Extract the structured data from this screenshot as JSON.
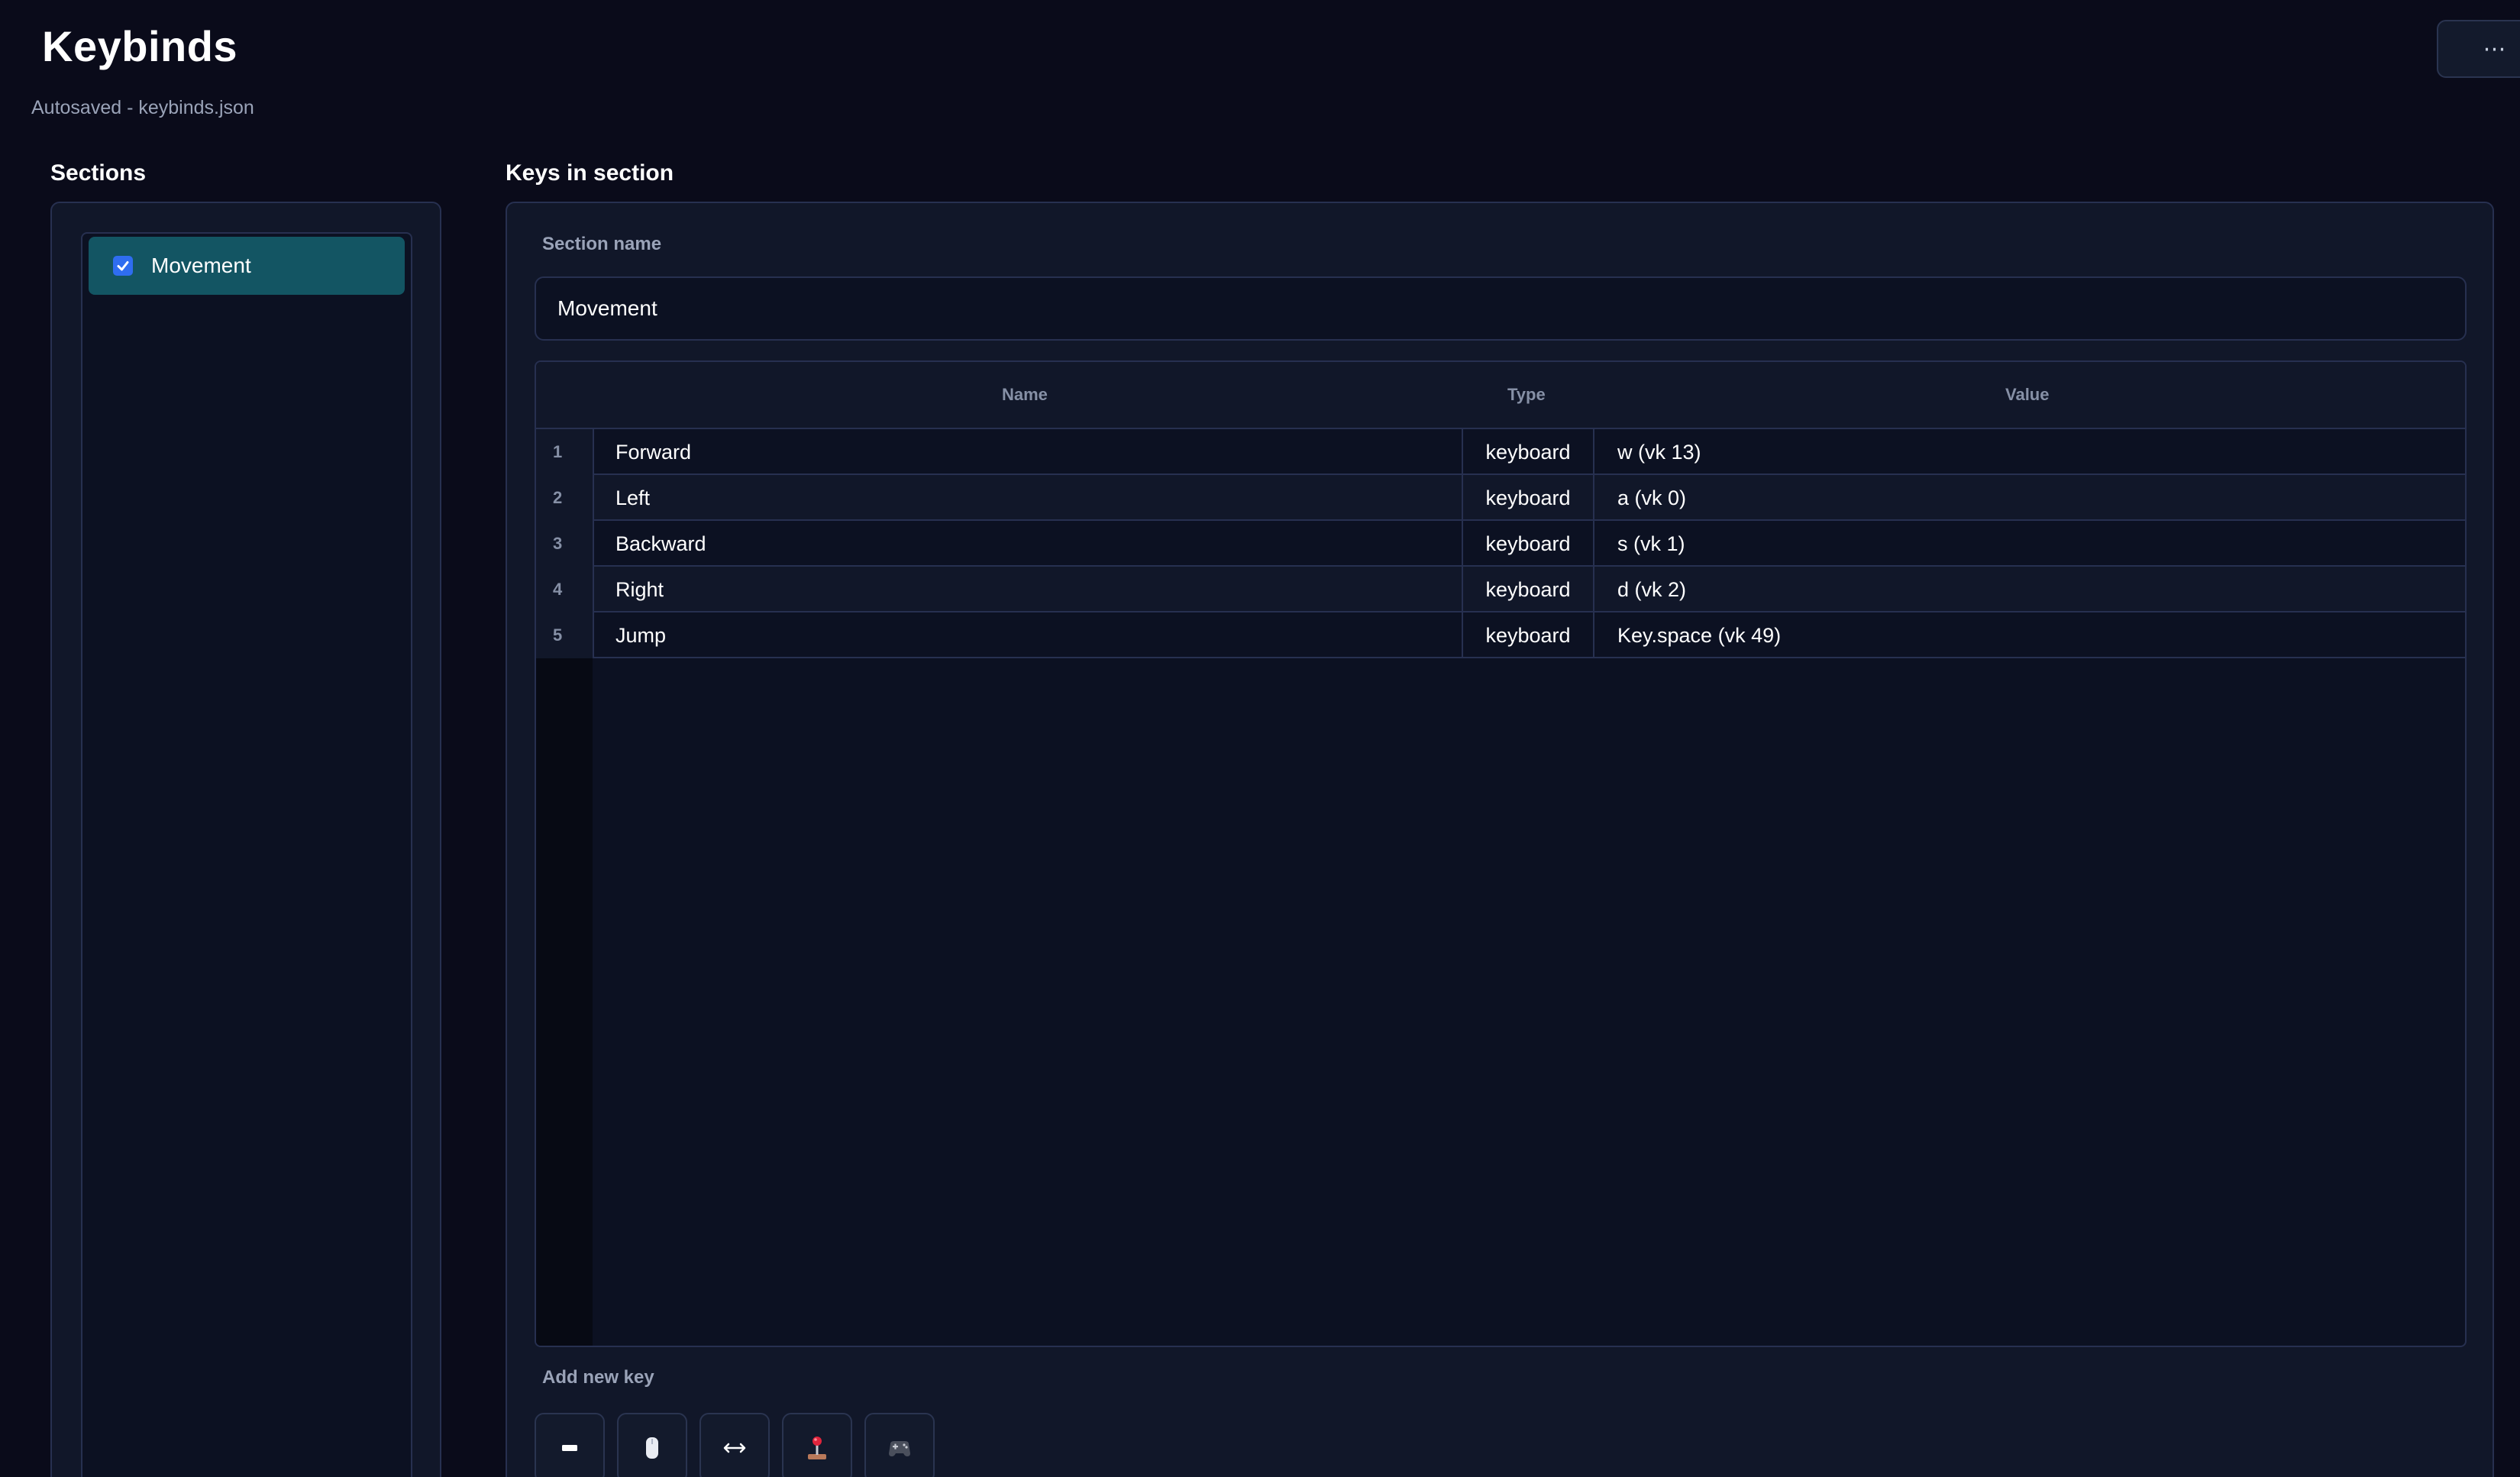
{
  "header": {
    "title": "Keybinds",
    "subtitle": "Autosaved  -  keybinds.json",
    "menu_label": "⋯"
  },
  "sections": {
    "heading": "Sections",
    "items": [
      {
        "label": "Movement",
        "checked": true
      }
    ]
  },
  "keys": {
    "heading": "Keys in section",
    "section_name_label": "Section name",
    "section_name_value": "Movement",
    "columns": {
      "name": "Name",
      "type": "Type",
      "value": "Value"
    },
    "rows": [
      {
        "num": "1",
        "name": "Forward",
        "type": "keyboard",
        "value": "w  (vk 13)"
      },
      {
        "num": "2",
        "name": "Left",
        "type": "keyboard",
        "value": "a  (vk 0)"
      },
      {
        "num": "3",
        "name": "Backward",
        "type": "keyboard",
        "value": "s  (vk 1)"
      },
      {
        "num": "4",
        "name": "Right",
        "type": "keyboard",
        "value": "d  (vk 2)"
      },
      {
        "num": "5",
        "name": "Jump",
        "type": "keyboard",
        "value": "Key.space  (vk 49)"
      }
    ],
    "add_new_label": "Add new key",
    "add_buttons": [
      {
        "icon": "keyboard-key-icon"
      },
      {
        "icon": "mouse-icon"
      },
      {
        "icon": "axis-arrows-icon"
      },
      {
        "icon": "joystick-icon"
      },
      {
        "icon": "gamepad-icon"
      }
    ]
  },
  "colors": {
    "background": "#0a0b1a",
    "panel": "#111729",
    "selected_section": "#135563",
    "checkbox": "#2f6df0",
    "border": "#273050"
  }
}
